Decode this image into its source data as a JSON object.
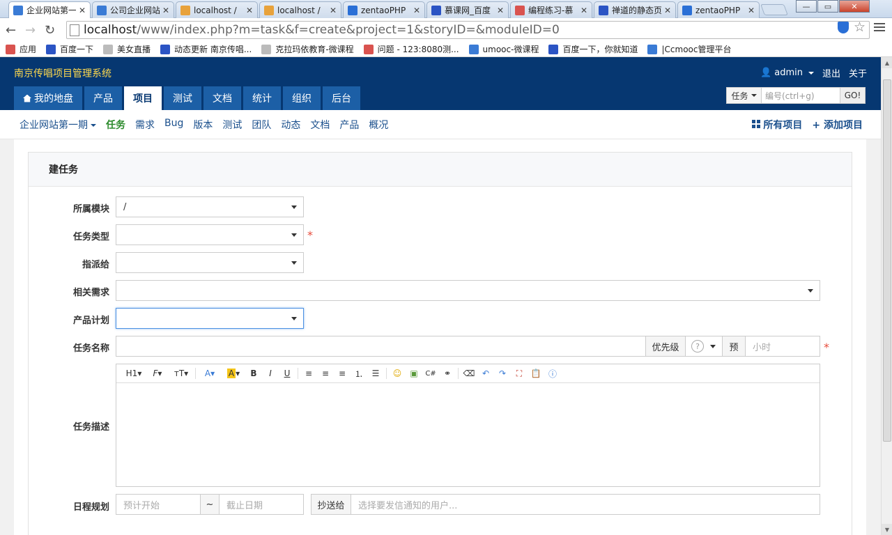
{
  "browser": {
    "tabs": [
      {
        "title": "企业网站第一",
        "icon_color": "#3a7bd5",
        "active": true
      },
      {
        "title": "公司企业网站",
        "icon_color": "#3a7bd5",
        "active": false
      },
      {
        "title": "localhost /",
        "icon_color": "#e8a23b",
        "active": false
      },
      {
        "title": "localhost /",
        "icon_color": "#e8a23b",
        "active": false
      },
      {
        "title": "zentaoPHP",
        "icon_color": "#2a6fd6",
        "active": false
      },
      {
        "title": "慕课网_百度",
        "icon_color": "#2b54c4",
        "active": false
      },
      {
        "title": "编程练习-慕",
        "icon_color": "#d9534f",
        "active": false
      },
      {
        "title": "禅道的静态页",
        "icon_color": "#2b54c4",
        "active": false
      },
      {
        "title": "zentaoPHP",
        "icon_color": "#2a6fd6",
        "active": false
      }
    ],
    "url_host": "localhost",
    "url_path": "/www/index.php?m=task&f=create&project=1&storyID=&moduleID=0",
    "bookmarks": [
      {
        "label": "应用",
        "color": "#d9534f"
      },
      {
        "label": "百度一下",
        "color": "#2b54c4"
      },
      {
        "label": "美女直播",
        "color": "#bbbbbb"
      },
      {
        "label": "动态更新 南京传唱...",
        "color": "#2b54c4"
      },
      {
        "label": "克拉玛依教育-微课程",
        "color": "#bbbbbb"
      },
      {
        "label": "问题 - 123:8080测...",
        "color": "#d9534f"
      },
      {
        "label": "umooc-微课程",
        "color": "#3a7bd5"
      },
      {
        "label": "百度一下，你就知道",
        "color": "#2b54c4"
      },
      {
        "label": "|Ccmooc管理平台",
        "color": "#3a7bd5"
      }
    ]
  },
  "app": {
    "brand": "南京传唱项目管理系统",
    "user": "admin",
    "logout": "退出",
    "about": "关于",
    "nav": [
      {
        "label": "我的地盘",
        "active": false
      },
      {
        "label": "产品",
        "active": false
      },
      {
        "label": "项目",
        "active": true
      },
      {
        "label": "测试",
        "active": false
      },
      {
        "label": "文档",
        "active": false
      },
      {
        "label": "统计",
        "active": false
      },
      {
        "label": "组织",
        "active": false
      },
      {
        "label": "后台",
        "active": false
      }
    ],
    "search": {
      "type": "任务",
      "placeholder": "编号(ctrl+g)",
      "go": "GO!"
    },
    "subnav": {
      "project": "企业网站第一期",
      "items": [
        {
          "label": "任务",
          "active": true
        },
        {
          "label": "需求",
          "active": false
        },
        {
          "label": "Bug",
          "active": false
        },
        {
          "label": "版本",
          "active": false
        },
        {
          "label": "测试",
          "active": false
        },
        {
          "label": "团队",
          "active": false
        },
        {
          "label": "动态",
          "active": false
        },
        {
          "label": "文档",
          "active": false
        },
        {
          "label": "产品",
          "active": false
        },
        {
          "label": "概况",
          "active": false
        }
      ],
      "all_projects": "所有项目",
      "add_project": "添加项目"
    }
  },
  "form": {
    "title": "建任务",
    "module_label": "所属模块",
    "module_value": "/",
    "type_label": "任务类型",
    "assign_label": "指派给",
    "story_label": "相关需求",
    "plan_label": "产品计划",
    "name_label": "任务名称",
    "priority_label": "优先级",
    "estimate_label": "预",
    "estimate_placeholder": "小时",
    "desc_label": "任务描述",
    "schedule_label": "日程规划",
    "est_start_placeholder": "预计开始",
    "tilde": "~",
    "deadline_placeholder": "截止日期",
    "mailto_label": "抄送给",
    "mailto_placeholder": "选择要发信通知的用户..."
  },
  "editor_toolbar": [
    "H1",
    "F",
    "TT",
    "A",
    "A",
    "B",
    "I",
    "U",
    "align-left",
    "align-center",
    "align-right",
    "ol",
    "ul",
    "emoji",
    "image",
    "code",
    "link",
    "eraser",
    "undo",
    "redo",
    "fullscreen",
    "paste",
    "help"
  ]
}
